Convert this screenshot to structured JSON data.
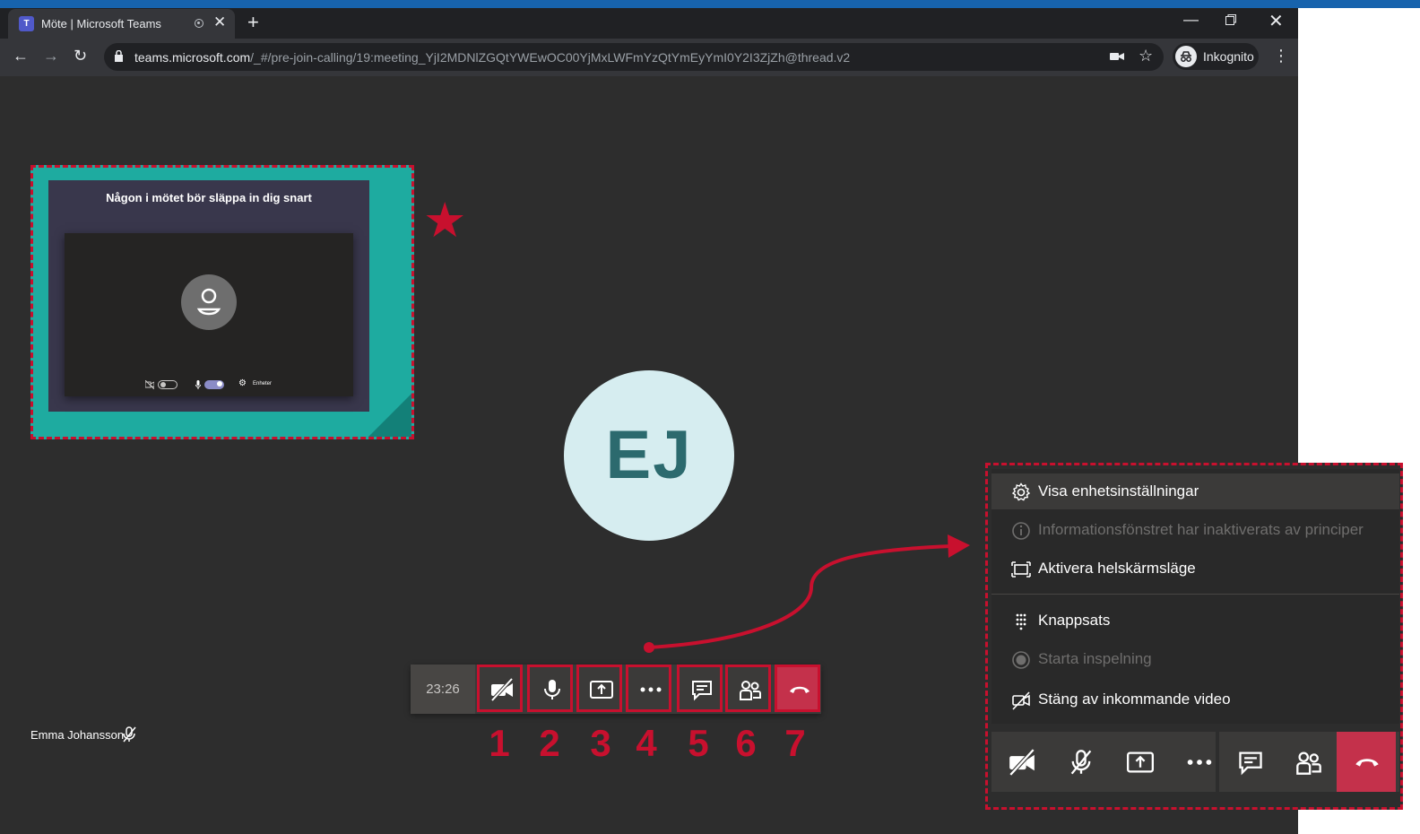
{
  "browser": {
    "tab_title": "Möte | Microsoft Teams",
    "url_host": "teams.microsoft.com",
    "url_path": "/_#/pre-join-calling/19:meeting_YjI2MDNlZGQtYWEwOC00YjMxLWFmYzQtYmEyYmI0Y2I3ZjZh@thread.v2",
    "profile_label": "Inkognito"
  },
  "prejoin": {
    "title": "Någon i mötet bör släppa in dig snart",
    "devices_label": "Enheter"
  },
  "avatar": {
    "initials": "EJ"
  },
  "callbar": {
    "timer": "23:26",
    "numbers": [
      "1",
      "2",
      "3",
      "4",
      "5",
      "6",
      "7"
    ]
  },
  "participant": {
    "name": "Emma Johansson"
  },
  "menu": {
    "items": [
      {
        "label": "Visa enhetsinställningar",
        "enabled": true,
        "icon": "gear-icon"
      },
      {
        "label": "Informationsfönstret har inaktiverats av principer",
        "enabled": false,
        "icon": "info-icon"
      },
      {
        "label": "Aktivera helskärmsläge",
        "enabled": true,
        "icon": "fullscreen-icon"
      },
      {
        "label": "Knappsats",
        "enabled": true,
        "icon": "dialpad-icon"
      },
      {
        "label": "Starta inspelning",
        "enabled": false,
        "icon": "record-icon"
      },
      {
        "label": "Stäng av inkommande video",
        "enabled": true,
        "icon": "video-off-icon"
      }
    ]
  },
  "colors": {
    "annotation_red": "#c8102e",
    "teams_dark": "#2d2d2d",
    "callout_teal": "#1eaba0",
    "hangup_red": "#c4314b",
    "avatar_bg": "#d6edf0"
  }
}
